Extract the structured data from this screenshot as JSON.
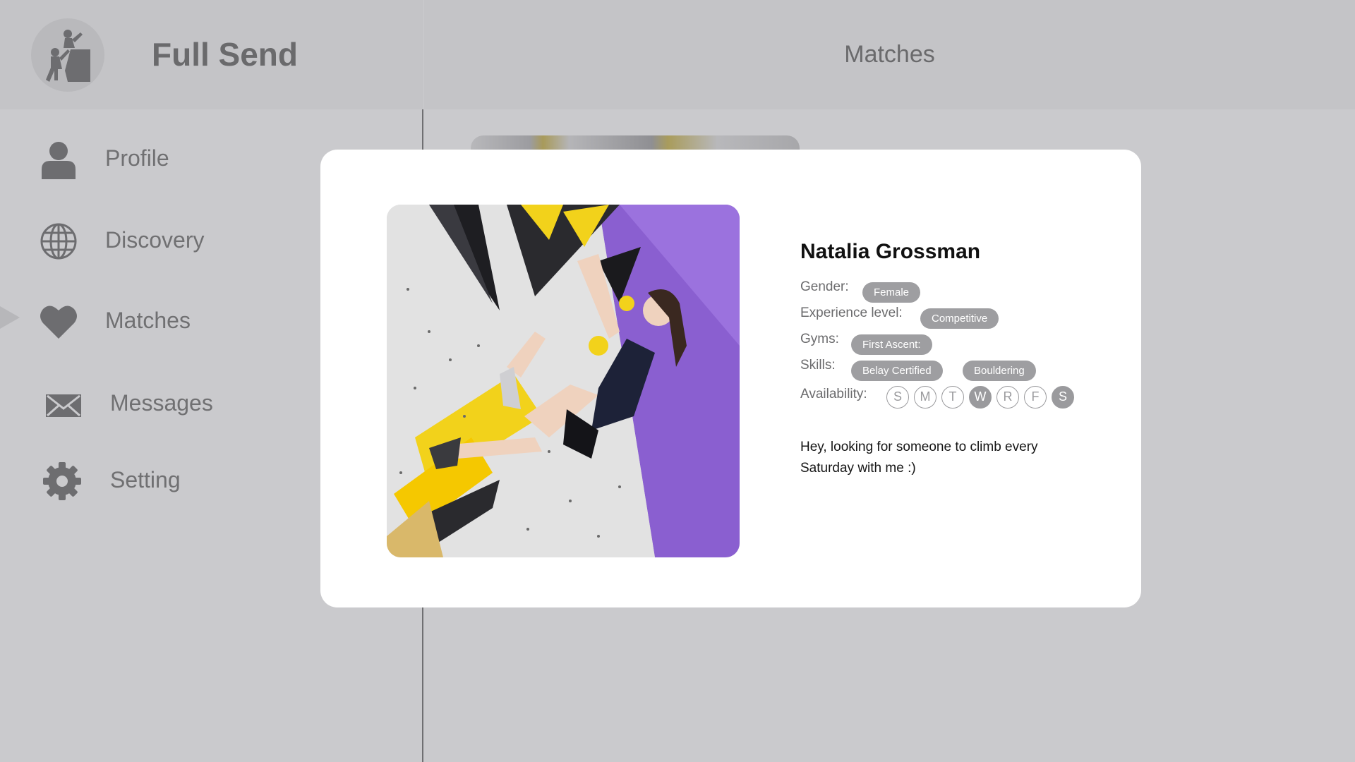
{
  "app": {
    "name": "Full Send"
  },
  "header": {
    "title": "Matches"
  },
  "sidebar": {
    "items": [
      {
        "label": "Profile",
        "icon": "user-icon"
      },
      {
        "label": "Discovery",
        "icon": "globe-icon"
      },
      {
        "label": "Matches",
        "icon": "heart-icon",
        "active": true
      },
      {
        "label": "Messages",
        "icon": "envelope-icon"
      },
      {
        "label": "Setting",
        "icon": "gear-icon"
      }
    ]
  },
  "match_modal": {
    "photo": {
      "subject": "climber on bouldering wall",
      "icon": "climber-photo"
    },
    "name": "Natalia Grossman",
    "gender_label": "Gender:",
    "gender": "Female",
    "experience_label": "Experience level:",
    "experience": "Competitive",
    "gyms_label": "Gyms:",
    "gyms": [
      "First Ascent:"
    ],
    "skills_label": "Skills:",
    "skills": [
      "Belay Certified",
      "Bouldering"
    ],
    "availability_label": "Availability:",
    "availability": [
      {
        "day": "S",
        "available": false
      },
      {
        "day": "M",
        "available": false
      },
      {
        "day": "T",
        "available": false
      },
      {
        "day": "W",
        "available": true
      },
      {
        "day": "R",
        "available": false
      },
      {
        "day": "F",
        "available": false
      },
      {
        "day": "S",
        "available": true
      }
    ],
    "bio": "Hey, looking for someone to climb every Saturday with me :)"
  },
  "colors": {
    "overlay_bg": "#cacacd",
    "tag_bg": "#9e9ea1",
    "modal_bg": "#ffffff",
    "text_dark": "#111111"
  }
}
